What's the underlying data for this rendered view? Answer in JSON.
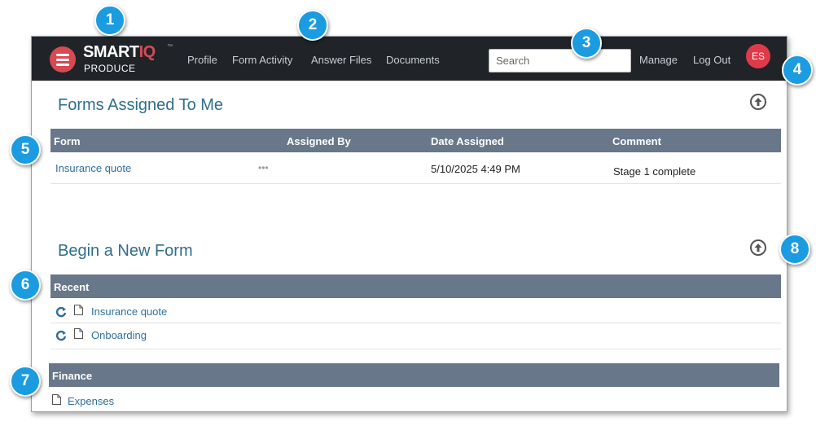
{
  "navbar": {
    "brand_main": "SMART",
    "brand_accent": "IQ",
    "brand_tm": "™",
    "brand_sub": "PRODUCE",
    "links": [
      "Profile",
      "Form Activity",
      "Answer Files",
      "Documents"
    ],
    "search_placeholder": "Search",
    "right_links": [
      "Manage",
      "Log Out"
    ],
    "avatar_initials": "ES"
  },
  "assigned": {
    "title": "Forms Assigned To Me",
    "headers": [
      "Form",
      "Assigned By",
      "Date Assigned",
      "Comment"
    ],
    "rows": [
      {
        "form": "Insurance quote",
        "assigned_by": "•••",
        "date": "5/10/2025 4:49 PM",
        "comment": "Stage 1 complete"
      }
    ]
  },
  "begin": {
    "title": "Begin a New Form",
    "recent_header": "Recent",
    "recent_items": [
      "Insurance quote",
      "Onboarding"
    ],
    "finance_header": "Finance",
    "finance_items": [
      "Expenses"
    ]
  },
  "callouts": [
    "1",
    "2",
    "3",
    "4",
    "5",
    "6",
    "7",
    "8"
  ],
  "colors": {
    "navbar_bg": "#202428",
    "brand_red": "#d84a52",
    "table_header": "#68778a",
    "link": "#2f6f9c",
    "title": "#2f6f8c",
    "callout": "#1b9be0",
    "avatar": "#e03a4a"
  }
}
